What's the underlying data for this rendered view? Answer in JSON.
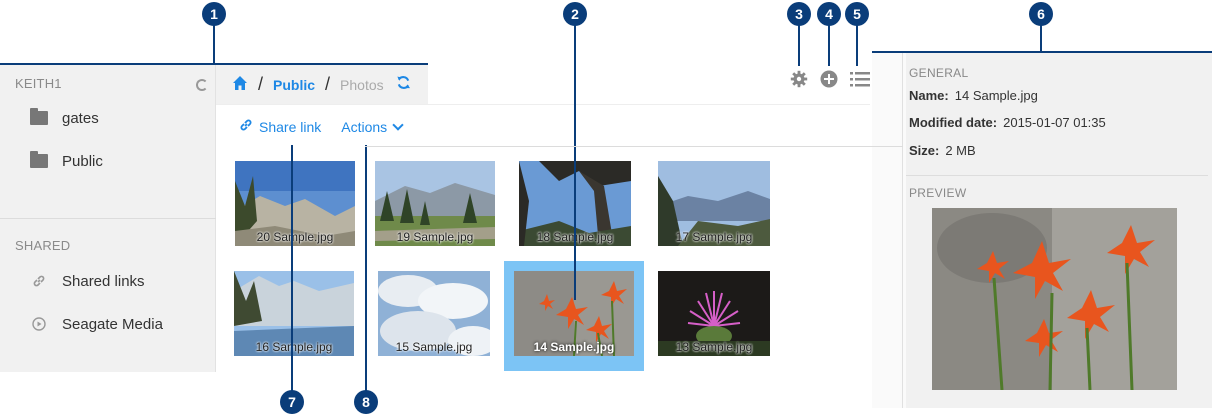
{
  "sidebar": {
    "header": "KEITH1",
    "items": [
      {
        "label": "gates",
        "icon": "folder-icon"
      },
      {
        "label": "Public",
        "icon": "folder-icon"
      }
    ],
    "shared_header": "SHARED",
    "shared_items": [
      {
        "label": "Shared links",
        "icon": "link-icon"
      },
      {
        "label": "Seagate Media",
        "icon": "play-icon"
      }
    ]
  },
  "breadcrumb": {
    "home_icon": "home-icon",
    "sep": "/",
    "public": "Public",
    "current": "Photos",
    "refresh_icon": "refresh-icon"
  },
  "toolbar": {
    "share_label": "Share link",
    "actions_label": "Actions"
  },
  "top_icons": [
    "gear-icon",
    "plus-circle-icon",
    "list-view-icon",
    "info-icon"
  ],
  "thumbnails": [
    {
      "caption": "20 Sample.jpg"
    },
    {
      "caption": "19 Sample.jpg"
    },
    {
      "caption": "18 Sample.jpg"
    },
    {
      "caption": "17 Sample.jpg"
    },
    {
      "caption": "16 Sample.jpg"
    },
    {
      "caption": "15 Sample.jpg"
    },
    {
      "caption": "14 Sample.jpg",
      "selected": true
    },
    {
      "caption": "13 Sample.jpg"
    }
  ],
  "details": {
    "general_header": "GENERAL",
    "name_label": "Name:",
    "name_value": "14 Sample.jpg",
    "modified_label": "Modified date:",
    "modified_value": "2015-01-07 01:35",
    "size_label": "Size:",
    "size_value": "2 MB",
    "preview_header": "PREVIEW"
  },
  "callouts": [
    "1",
    "2",
    "3",
    "4",
    "5",
    "6",
    "7",
    "8"
  ],
  "colors": {
    "accent": "#1e88e5",
    "callout": "#0a3d7a",
    "selection": "#7cc4f5",
    "panel_bg": "#f1f1f1"
  }
}
